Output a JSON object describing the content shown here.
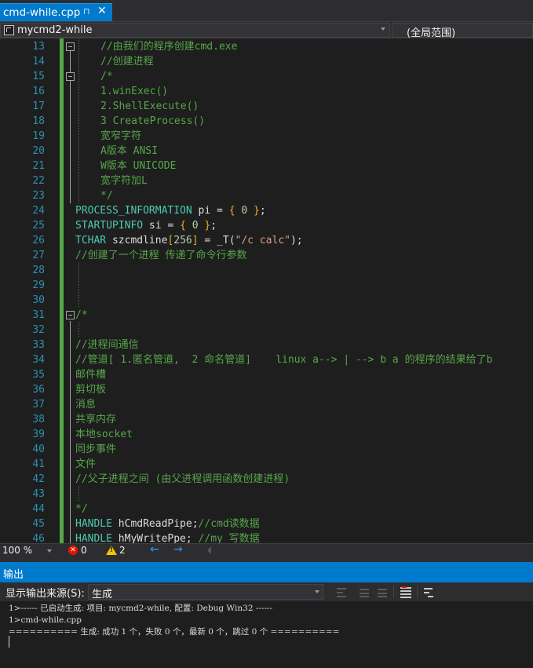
{
  "tab": {
    "title": "cmd-while.cpp",
    "pin_glyph": "⊓",
    "close_glyph": "✕"
  },
  "navbar": {
    "project": "mycmd2-while",
    "scope": "(全局范围)"
  },
  "code_lines": [
    {
      "n": "13",
      "t": [
        [
          "cmt",
          "//由我们的程序创建cmd.exe"
        ]
      ],
      "indent": 2
    },
    {
      "n": "14",
      "t": [
        [
          "cmt",
          "//创建进程"
        ]
      ],
      "indent": 2
    },
    {
      "n": "15",
      "t": [
        [
          "cmt",
          "/*"
        ]
      ],
      "indent": 2
    },
    {
      "n": "16",
      "t": [
        [
          "cmt",
          "1.winExec()"
        ]
      ],
      "indent": 2
    },
    {
      "n": "17",
      "t": [
        [
          "cmt",
          "2.ShellExecute()"
        ]
      ],
      "indent": 2
    },
    {
      "n": "18",
      "t": [
        [
          "cmt",
          "3 CreateProcess()"
        ]
      ],
      "indent": 2
    },
    {
      "n": "19",
      "t": [
        [
          "cmt",
          "宽窄字符"
        ]
      ],
      "indent": 2
    },
    {
      "n": "20",
      "t": [
        [
          "cmt",
          "A版本 ANSI"
        ]
      ],
      "indent": 2
    },
    {
      "n": "21",
      "t": [
        [
          "cmt",
          "W版本 UNICODE"
        ]
      ],
      "indent": 2
    },
    {
      "n": "22",
      "t": [
        [
          "cmt",
          "宽字符加L"
        ]
      ],
      "indent": 2
    },
    {
      "n": "23",
      "t": [
        [
          "cmt",
          "*/"
        ]
      ],
      "indent": 2
    },
    {
      "n": "24",
      "t": [
        [
          "ty",
          "PROCESS_INFORMATION"
        ],
        [
          "id",
          " pi = "
        ],
        [
          "br",
          "{"
        ],
        [
          "id",
          " "
        ],
        [
          "num",
          "0"
        ],
        [
          "id",
          " "
        ],
        [
          "br",
          "}"
        ],
        [
          "id",
          ";"
        ]
      ],
      "indent": 0
    },
    {
      "n": "25",
      "t": [
        [
          "ty",
          "STARTUPINFO"
        ],
        [
          "id",
          " si = "
        ],
        [
          "br",
          "{"
        ],
        [
          "id",
          " "
        ],
        [
          "num",
          "0"
        ],
        [
          "id",
          " "
        ],
        [
          "br",
          "}"
        ],
        [
          "id",
          ";"
        ]
      ],
      "indent": 0
    },
    {
      "n": "26",
      "t": [
        [
          "ty",
          "TCHAR"
        ],
        [
          "id",
          " szcmdline"
        ],
        [
          "br",
          "["
        ],
        [
          "num",
          "256"
        ],
        [
          "br",
          "]"
        ],
        [
          "id",
          " = _T("
        ],
        [
          "str",
          "\"/c calc\""
        ],
        [
          "id",
          ");"
        ]
      ],
      "indent": 0
    },
    {
      "n": "27",
      "t": [
        [
          "cmt",
          "//创建了一个进程 传递了命令行参数"
        ]
      ],
      "indent": 0
    },
    {
      "n": "28",
      "t": [],
      "indent": 0
    },
    {
      "n": "29",
      "t": [],
      "indent": 0
    },
    {
      "n": "30",
      "t": [],
      "indent": 0
    },
    {
      "n": "31",
      "t": [
        [
          "cmt",
          "/*"
        ]
      ],
      "indent": 0
    },
    {
      "n": "32",
      "t": [],
      "indent": 0
    },
    {
      "n": "33",
      "t": [
        [
          "cmt",
          "//进程间通信"
        ]
      ],
      "indent": 0
    },
    {
      "n": "34",
      "t": [
        [
          "cmt",
          "//管道[ 1.匿名管道,  2 命名管道]    linux a--> | --> b a 的程序的结果给了b"
        ]
      ],
      "indent": 0
    },
    {
      "n": "35",
      "t": [
        [
          "cmt",
          "邮件槽"
        ]
      ],
      "indent": 0
    },
    {
      "n": "36",
      "t": [
        [
          "cmt",
          "剪切板"
        ]
      ],
      "indent": 0
    },
    {
      "n": "37",
      "t": [
        [
          "cmt",
          "消息"
        ]
      ],
      "indent": 0
    },
    {
      "n": "38",
      "t": [
        [
          "cmt",
          "共享内存"
        ]
      ],
      "indent": 0
    },
    {
      "n": "39",
      "t": [
        [
          "cmt",
          "本地socket"
        ]
      ],
      "indent": 0
    },
    {
      "n": "40",
      "t": [
        [
          "cmt",
          "同步事件"
        ]
      ],
      "indent": 0
    },
    {
      "n": "41",
      "t": [
        [
          "cmt",
          "文件"
        ]
      ],
      "indent": 0
    },
    {
      "n": "42",
      "t": [
        [
          "cmt",
          "//父子进程之间 (由父进程调用函数创建进程)"
        ]
      ],
      "indent": 0
    },
    {
      "n": "43",
      "t": [],
      "indent": 0
    },
    {
      "n": "44",
      "t": [
        [
          "cmt",
          "*/"
        ]
      ],
      "indent": 0
    },
    {
      "n": "45",
      "t": [
        [
          "ty",
          "HANDLE"
        ],
        [
          "id",
          " hCmdReadPipe;"
        ],
        [
          "cmt",
          "//cmd读数据"
        ]
      ],
      "indent": 0
    },
    {
      "n": "46",
      "t": [
        [
          "ty",
          "HANDLE"
        ],
        [
          "id",
          " hMyWritePpe; "
        ],
        [
          "cmt",
          "//my 写数据"
        ]
      ],
      "indent": 0
    }
  ],
  "status": {
    "zoom": "100 %",
    "errors": "0",
    "warnings": "2",
    "back_glyph": "←",
    "forward_glyph": "→"
  },
  "output": {
    "title": "输出",
    "source_label": "显示输出来源(S):",
    "source_value": "生成",
    "lines": [
      "1>------ 已启动生成: 项目: mycmd2-while, 配置: Debug Win32 ------",
      "1>cmd-while.cpp",
      "========== 生成: 成功 1 个，失败 0 个，最新 0 个，跳过 0 个 =========="
    ]
  },
  "colors": {
    "accent": "#007acc",
    "comment": "#57a64a",
    "type": "#4ec9b0",
    "line_number": "#2b91af",
    "number": "#b5cea8",
    "string": "#d69d85",
    "bracket": "#e6b422",
    "background": "#1e1e1e"
  }
}
